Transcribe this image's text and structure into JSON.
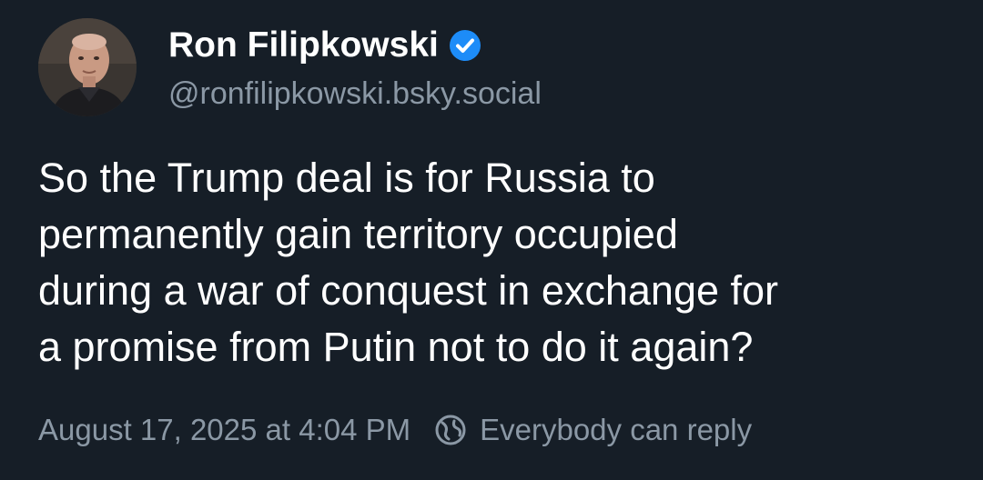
{
  "post": {
    "author": {
      "display_name": "Ron Filipkowski",
      "handle": "@ronfilipkowski.bsky.social",
      "verified": true,
      "avatar_icon": "profile-photo"
    },
    "text": "So the Trump deal is for Russia to\npermanently gain territory occupied\nduring a war of conquest in exchange for\na promise from Putin not to do it again?",
    "timestamp": "August 17, 2025 at 4:04 PM",
    "reply_setting": {
      "icon": "globe-icon",
      "label": "Everybody can reply"
    }
  },
  "colors": {
    "background": "#161e27",
    "text_primary": "#ffffff",
    "text_secondary": "#8b98a5",
    "verified_badge": "#1d8cf8"
  }
}
